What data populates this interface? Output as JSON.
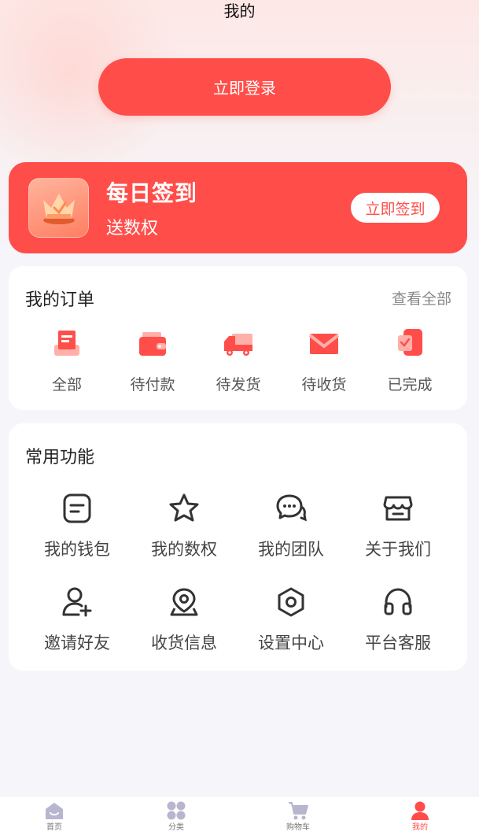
{
  "header": {
    "title": "我的"
  },
  "login": {
    "label": "立即登录"
  },
  "checkin": {
    "title": "每日签到",
    "subtitle": "送数权",
    "button": "立即签到",
    "icon": "crown-icon"
  },
  "orders": {
    "title": "我的订单",
    "view_all": "查看全部",
    "items": [
      {
        "label": "全部",
        "icon": "order-all-icon"
      },
      {
        "label": "待付款",
        "icon": "wallet-icon"
      },
      {
        "label": "待发货",
        "icon": "truck-icon"
      },
      {
        "label": "待收货",
        "icon": "envelope-icon"
      },
      {
        "label": "已完成",
        "icon": "completed-doc-icon"
      }
    ]
  },
  "functions": {
    "title": "常用功能",
    "items": [
      {
        "label": "我的钱包",
        "icon": "wallet-outline-icon"
      },
      {
        "label": "我的数权",
        "icon": "star-icon"
      },
      {
        "label": "我的团队",
        "icon": "chat-icon"
      },
      {
        "label": "关于我们",
        "icon": "store-icon"
      },
      {
        "label": "邀请好友",
        "icon": "add-user-icon"
      },
      {
        "label": "收货信息",
        "icon": "location-icon"
      },
      {
        "label": "设置中心",
        "icon": "settings-hex-icon"
      },
      {
        "label": "平台客服",
        "icon": "headset-icon"
      }
    ]
  },
  "tabbar": {
    "items": [
      {
        "label": "首页",
        "icon": "home-icon",
        "active": false
      },
      {
        "label": "分类",
        "icon": "category-icon",
        "active": false
      },
      {
        "label": "购物车",
        "icon": "cart-icon",
        "active": false
      },
      {
        "label": "我的",
        "icon": "profile-icon",
        "active": true
      }
    ]
  },
  "colors": {
    "accent": "#ff4e4a",
    "accent_light": "#ffb0aa",
    "tab_inactive": "#b8b6cf",
    "icon_dark": "#333333"
  }
}
